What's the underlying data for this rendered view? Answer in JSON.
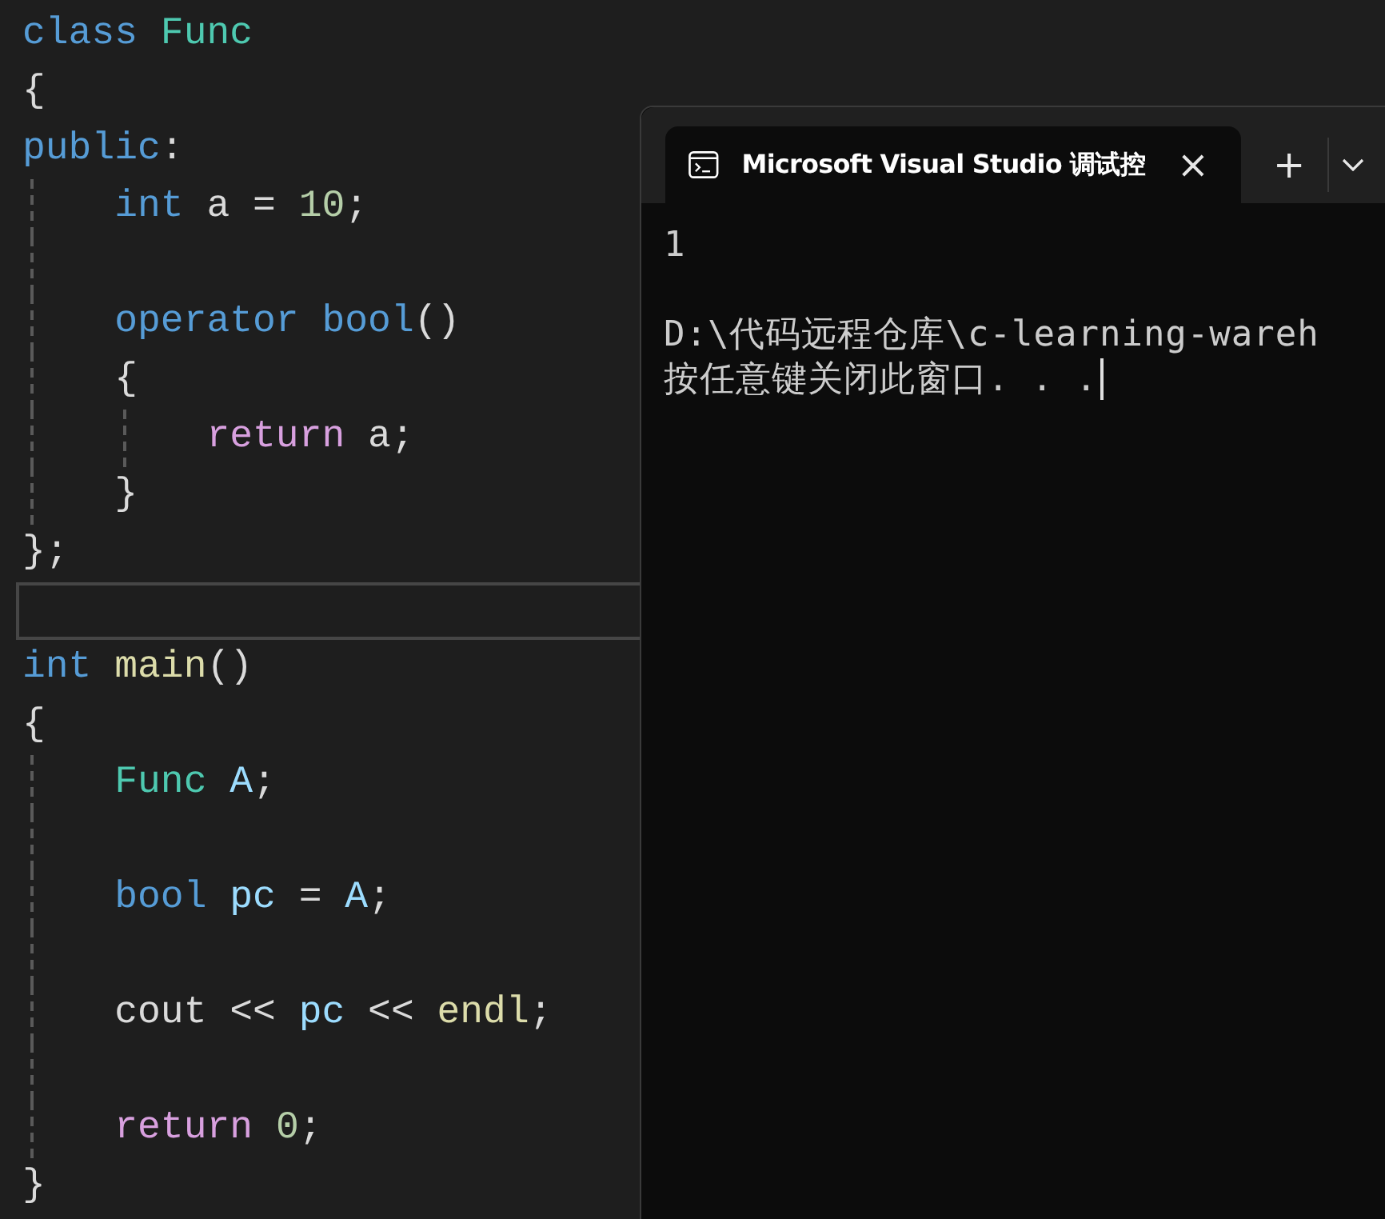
{
  "editor": {
    "lines": [
      {
        "tokens": [
          {
            "text": "class ",
            "kind": "keyword"
          },
          {
            "text": "Func",
            "kind": "type"
          }
        ]
      },
      {
        "tokens": [
          {
            "text": "{",
            "kind": "plain"
          }
        ]
      },
      {
        "tokens": [
          {
            "text": "public",
            "kind": "keyword"
          },
          {
            "text": ":",
            "kind": "plain"
          }
        ]
      },
      {
        "tokens": [
          {
            "text": "    int ",
            "kind": "keyword"
          },
          {
            "text": "a = ",
            "kind": "plain"
          },
          {
            "text": "10",
            "kind": "number"
          },
          {
            "text": ";",
            "kind": "plain"
          }
        ],
        "blank_after": true
      },
      {
        "tokens": [
          {
            "text": "    operator bool",
            "kind": "keyword"
          },
          {
            "text": "()",
            "kind": "plain"
          }
        ]
      },
      {
        "tokens": [
          {
            "text": "    {",
            "kind": "plain"
          }
        ]
      },
      {
        "tokens": [
          {
            "text": "        return ",
            "kind": "control"
          },
          {
            "text": "a;",
            "kind": "plain"
          }
        ]
      },
      {
        "tokens": [
          {
            "text": "    }",
            "kind": "plain"
          }
        ]
      },
      {
        "tokens": [
          {
            "text": "};",
            "kind": "plain"
          }
        ]
      },
      {
        "current": true
      },
      {
        "tokens": [
          {
            "text": "int ",
            "kind": "keyword"
          },
          {
            "text": "main",
            "kind": "function"
          },
          {
            "text": "()",
            "kind": "plain"
          }
        ]
      },
      {
        "tokens": [
          {
            "text": "{",
            "kind": "plain"
          }
        ]
      },
      {
        "tokens": [
          {
            "text": "    Func ",
            "kind": "type"
          },
          {
            "text": "A",
            "kind": "variable"
          },
          {
            "text": ";",
            "kind": "plain"
          }
        ],
        "blank_after": true
      },
      {
        "tokens": [
          {
            "text": "    bool ",
            "kind": "keyword"
          },
          {
            "text": "pc",
            "kind": "variable"
          },
          {
            "text": " = ",
            "kind": "plain"
          },
          {
            "text": "A",
            "kind": "variable"
          },
          {
            "text": ";",
            "kind": "plain"
          }
        ],
        "blank_after": true
      },
      {
        "tokens": [
          {
            "text": "    cout << ",
            "kind": "plain"
          },
          {
            "text": "pc",
            "kind": "variable"
          },
          {
            "text": " << ",
            "kind": "plain"
          },
          {
            "text": "endl",
            "kind": "function"
          },
          {
            "text": ";",
            "kind": "plain"
          }
        ],
        "blank_after": true
      },
      {
        "tokens": [
          {
            "text": "    return ",
            "kind": "control"
          },
          {
            "text": "0",
            "kind": "number"
          },
          {
            "text": ";",
            "kind": "plain"
          }
        ]
      },
      {
        "tokens": [
          {
            "text": "}",
            "kind": "plain"
          }
        ]
      }
    ]
  },
  "terminal": {
    "tab": {
      "title": "Microsoft Visual Studio 调试控",
      "close": "×",
      "selected": true
    },
    "new_tab": "+",
    "output": [
      {
        "text": "1",
        "blank_after": true
      },
      {
        "text": "D:\\代码远程仓库\\c-learning-wareh"
      },
      {
        "text": "按任意键关闭此窗口. . ."
      }
    ]
  }
}
